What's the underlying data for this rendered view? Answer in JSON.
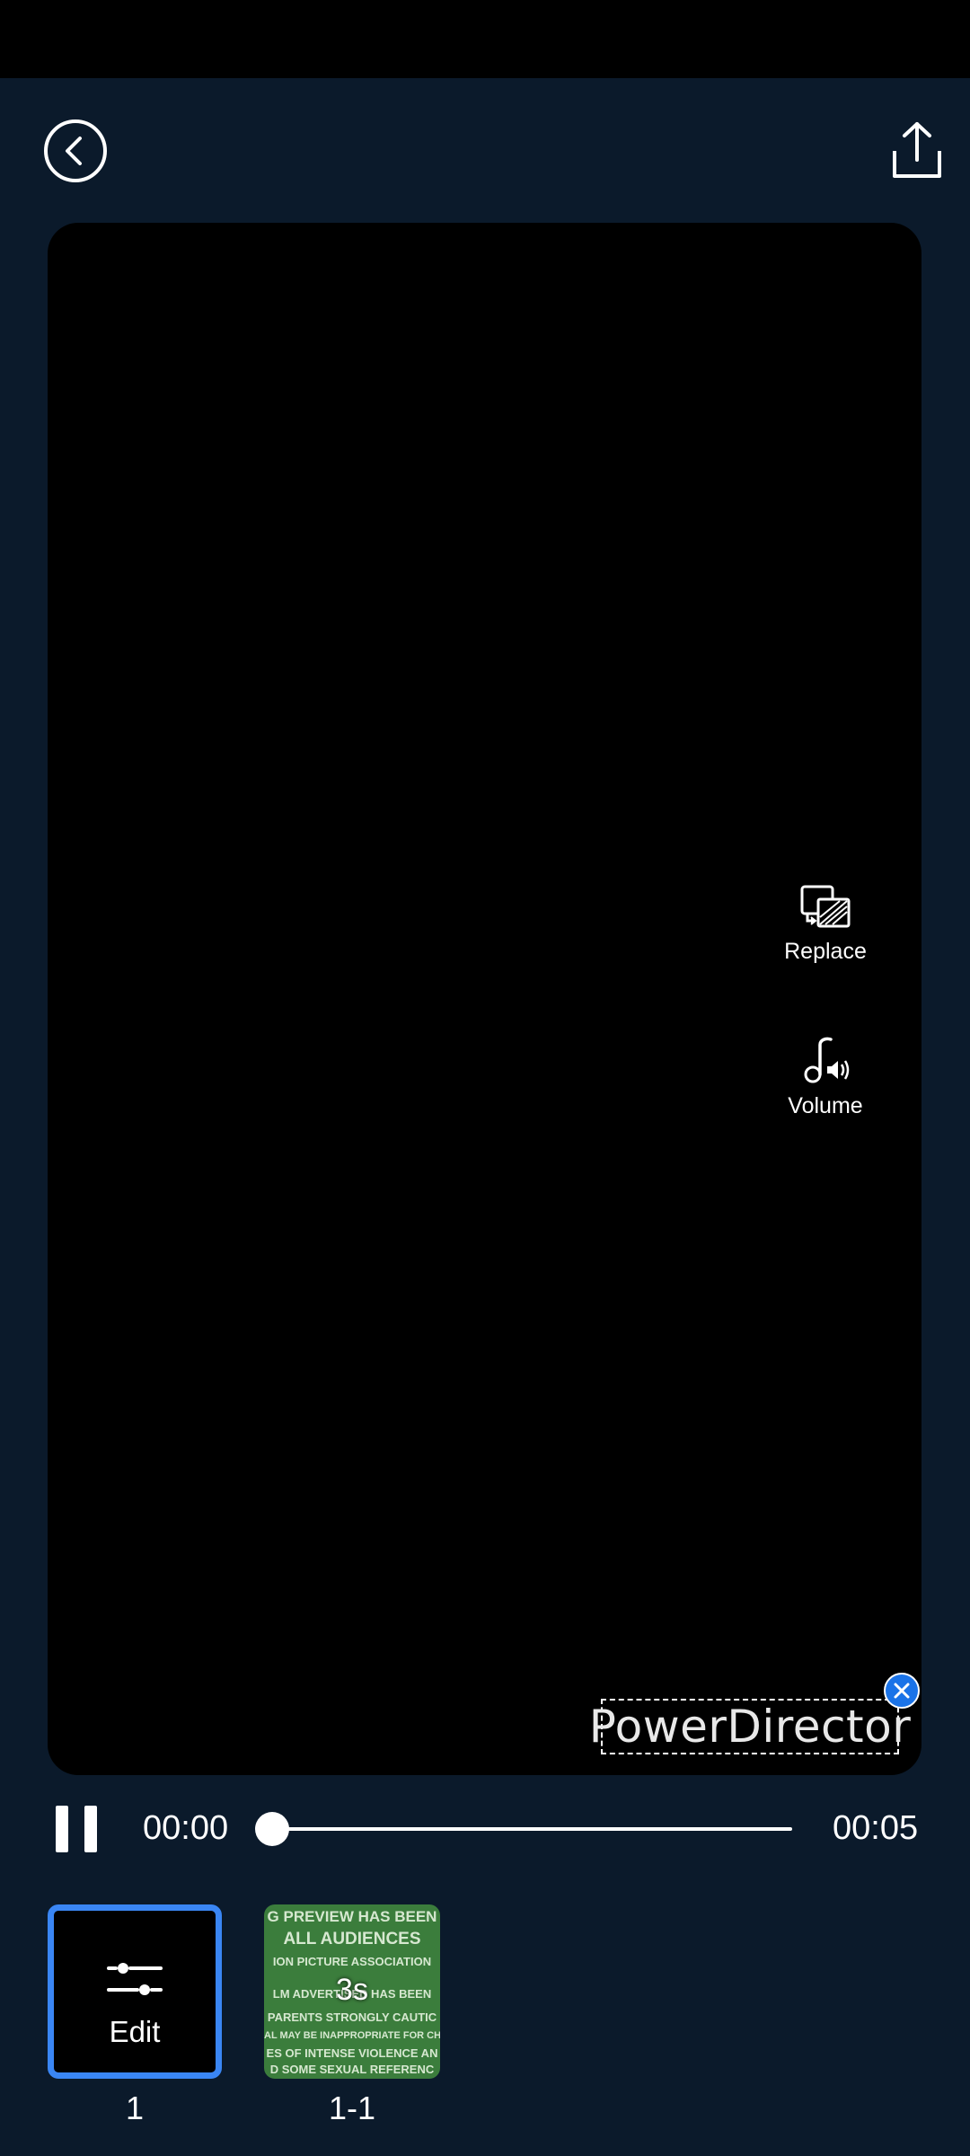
{
  "header": {
    "back_icon": "chevron-left-circle-icon",
    "share_icon": "share-upload-icon"
  },
  "preview": {
    "tools": [
      {
        "label": "Replace",
        "icon": "replace-media-icon"
      },
      {
        "label": "Volume",
        "icon": "music-volume-icon"
      }
    ],
    "watermark": {
      "text": "PowerDirector",
      "close_icon": "close-icon"
    }
  },
  "playback": {
    "pause_icon": "pause-icon",
    "current_time": "00:00",
    "total_time": "00:05",
    "progress": 0
  },
  "clips": [
    {
      "type": "edit",
      "label": "Edit",
      "number": "1",
      "icon": "sliders-icon",
      "selected": true
    },
    {
      "type": "video",
      "duration": "3s",
      "number": "1-1",
      "thumbnail_text": [
        "G PREVIEW HAS BEEN",
        "ALL AUDIENCES",
        "ION PICTURE ASSOCIATION",
        "LM ADVERTISED HAS BEEN",
        "PARENTS STRONGLY CAUTIC",
        "AL MAY BE INAPPROPRIATE FOR CHILD",
        "ES OF INTENSE VIOLENCE AN",
        "D SOME SEXUAL REFERENC"
      ]
    }
  ],
  "colors": {
    "background": "#0b1a2b",
    "accent": "#3a86f4",
    "preview": "#000000"
  }
}
